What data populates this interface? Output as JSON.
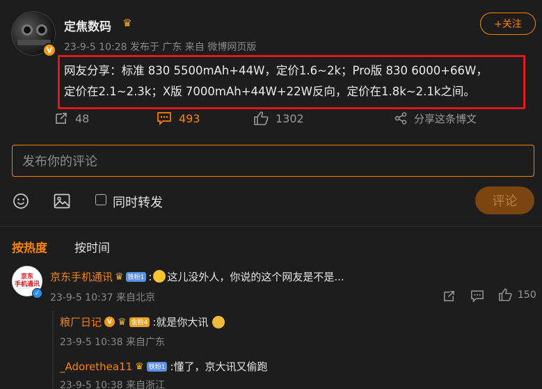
{
  "post": {
    "username": "定焦数码",
    "meta": "23-9-5 10:28 发布于 广东 来自 微博网页版",
    "follow_label": "+关注",
    "text_line1": "网友分享：标准 830 5500mAh+44W，定价1.6~2k；Pro版 830 6000+66W，",
    "text_line2": "定价在2.1~2.3k；X版 7000mAh+44W+22W反向，定价在1.8k~2.1k之间。",
    "reposts": "48",
    "comments": "493",
    "likes": "1302",
    "share_label": "分享这条博文",
    "avatar_badge": "V"
  },
  "composer": {
    "placeholder": "发布你的评论",
    "repost_label": "同时转发",
    "submit_label": "评论"
  },
  "sort": {
    "hot": "按热度",
    "time": "按时间"
  },
  "comments": [
    {
      "name": "京东手机通讯",
      "avatar_text_1": "京东",
      "avatar_text_2": "手机通讯",
      "badge": "铁粉1",
      "text": "这儿没外人，你说的这个网友是不是...",
      "time": "23-9-5 10:37 来自北京",
      "likes": "150"
    }
  ],
  "replies": [
    {
      "name": "粮厂日记",
      "verify": "V",
      "badge": "金粉4",
      "text": ":就是你大讯",
      "time": "23-9-5 10:38 来自广东"
    },
    {
      "name": "_Adorethea11",
      "badge": "铁粉1",
      "text": ":懂了，京大讯又偷跑",
      "time": "23-9-5 10:38 来自浙江"
    }
  ],
  "colors": {
    "accent": "#ff8200",
    "highlight_border": "#e4181c",
    "background": "#1d1d1d"
  }
}
